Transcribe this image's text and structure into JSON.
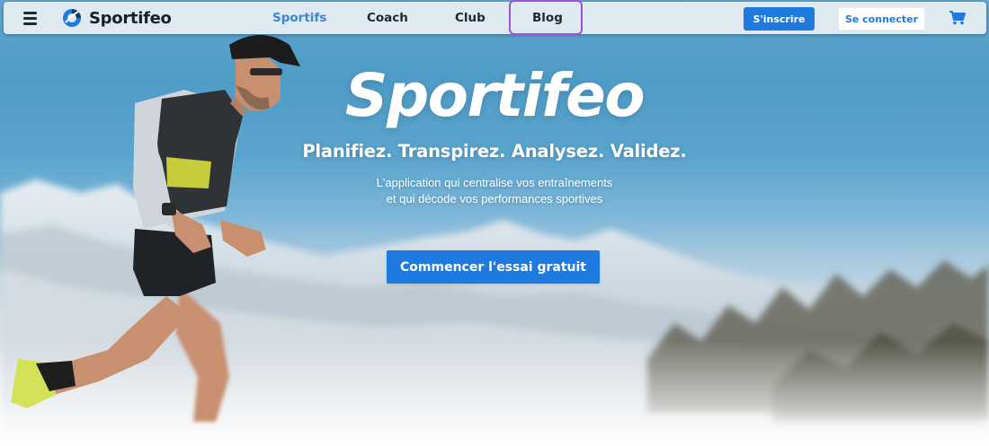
{
  "navbar": {
    "brand": "Sportifeo",
    "links": [
      {
        "label": "Sportifs",
        "active": true
      },
      {
        "label": "Coach",
        "active": false
      },
      {
        "label": "Club",
        "active": false
      },
      {
        "label": "Blog",
        "active": false,
        "highlighted": true
      }
    ],
    "signup_label": "S'inscrire",
    "login_label": "Se connecter",
    "icons": {
      "menu": "hamburger-menu-icon",
      "logo": "sportifeo-logo-icon",
      "cart": "shopping-cart-icon"
    }
  },
  "hero": {
    "title": "Sportifeo",
    "tagline": "Planifiez. Transpirez. Analysez. Validez.",
    "description_line1": "L'application qui centralise vos entraînements",
    "description_line2": "et qui décode vos performances sportives",
    "cta_label": "Commencer l'essai gratuit"
  },
  "colors": {
    "accent": "#1f7ae0",
    "active_link": "#3a86d6",
    "highlight_border": "#9b52e0",
    "navbar_bg": "#dfe9f0"
  }
}
